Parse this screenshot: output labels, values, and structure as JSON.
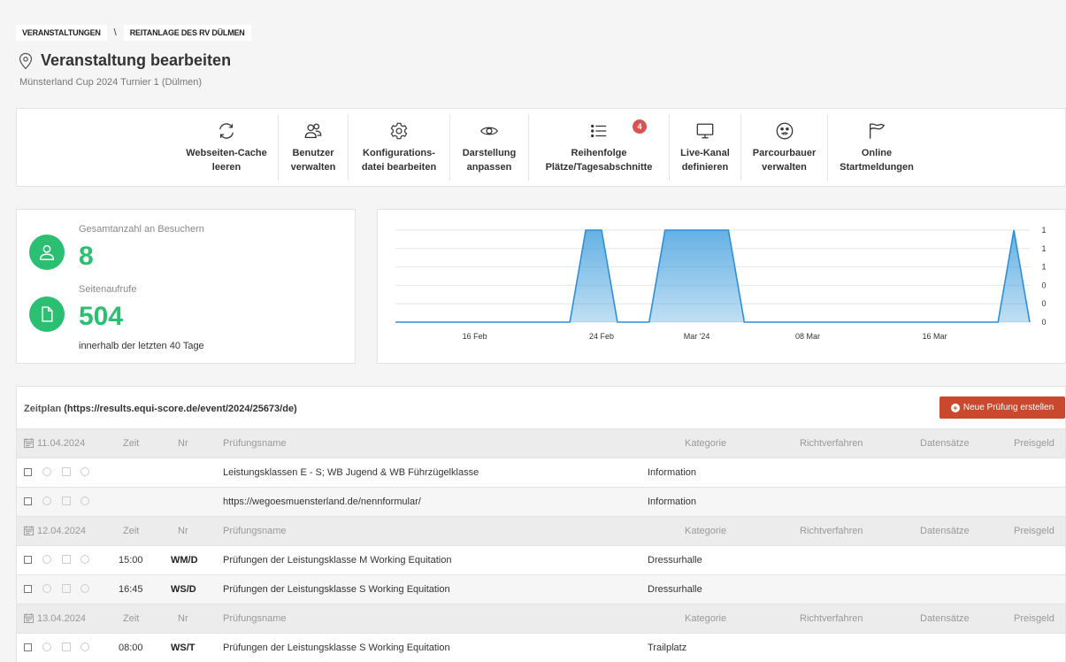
{
  "breadcrumb": {
    "items": [
      "VERANSTALTUNGEN",
      "REITANLAGE DES RV DÜLMEN"
    ],
    "separator": "\\"
  },
  "page": {
    "title": "Veranstaltung bearbeiten",
    "subtitle": "Münsterland Cup 2024 Turnier 1 (Dülmen)"
  },
  "toolbar": {
    "items": [
      {
        "label": "Webseiten-Cache\nleeren",
        "icon": "refresh-icon"
      },
      {
        "label": "Benutzer\nverwalten",
        "icon": "users-icon"
      },
      {
        "label": "Konfigurations-\ndatei bearbeiten",
        "icon": "gear-icon"
      },
      {
        "label": "Darstellung\nanpassen",
        "icon": "eye-icon"
      },
      {
        "label": "Reihenfolge\nPlätze/Tagesabschnitte",
        "icon": "list-icon",
        "badge": "4"
      },
      {
        "label": "Live-Kanal\ndefinieren",
        "icon": "monitor-icon"
      },
      {
        "label": "Parcourbauer\nverwalten",
        "icon": "face-icon"
      },
      {
        "label": "Online\nStartmeldungen",
        "icon": "flag-icon"
      }
    ]
  },
  "stats": {
    "visitors_label": "Gesamtanzahl an Besuchern",
    "visitors_value": "8",
    "pageviews_label": "Seitenaufrufe",
    "pageviews_value": "504",
    "period": "innerhalb der letzten 40 Tage",
    "accent": "#2bbf72"
  },
  "chart_data": {
    "type": "area",
    "x_start": "2024-02-11",
    "x": [
      "2024-02-11",
      "2024-02-12",
      "2024-02-13",
      "2024-02-14",
      "2024-02-15",
      "2024-02-16",
      "2024-02-17",
      "2024-02-18",
      "2024-02-19",
      "2024-02-20",
      "2024-02-21",
      "2024-02-22",
      "2024-02-23",
      "2024-02-24",
      "2024-02-25",
      "2024-02-26",
      "2024-02-27",
      "2024-02-28",
      "2024-02-29",
      "2024-03-01",
      "2024-03-02",
      "2024-03-03",
      "2024-03-04",
      "2024-03-05",
      "2024-03-06",
      "2024-03-07",
      "2024-03-08",
      "2024-03-09",
      "2024-03-10",
      "2024-03-11",
      "2024-03-12",
      "2024-03-13",
      "2024-03-14",
      "2024-03-15",
      "2024-03-16",
      "2024-03-17",
      "2024-03-18",
      "2024-03-19",
      "2024-03-20",
      "2024-03-21",
      "2024-03-22"
    ],
    "series": [
      {
        "values": [
          0,
          0,
          0,
          0,
          0,
          0,
          0,
          0,
          0,
          0,
          0,
          0,
          1,
          1,
          0,
          0,
          0,
          1,
          1,
          1,
          1,
          1,
          0,
          0,
          0,
          0,
          0,
          0,
          0,
          0,
          0,
          0,
          0,
          0,
          0,
          0,
          0,
          0,
          0,
          1,
          0
        ]
      }
    ],
    "x_tick_labels": [
      "16 Feb",
      "24 Feb",
      "Mar '24",
      "08 Mar",
      "16 Mar"
    ],
    "y_tick_labels": [
      "1",
      "1",
      "1",
      "0",
      "0",
      "0"
    ],
    "ylim": [
      0,
      1
    ],
    "grid": true,
    "color": "#4aa3df"
  },
  "schedule": {
    "title_prefix": "Zeitplan",
    "title_url": "(https://results.equi-score.de/event/2024/25673/de)",
    "new_button": "Neue Prüfung erstellen",
    "columns": {
      "time": "Zeit",
      "nr": "Nr",
      "name": "Prüfungsname",
      "category": "Kategorie",
      "judging": "Richtverfahren",
      "records": "Datensätze",
      "prize": "Preisgeld"
    },
    "days": [
      {
        "date": "11.04.2024",
        "rows": [
          {
            "time": "",
            "nr": "",
            "name": "Leistungsklassen E - S; WB Jugend & WB Führzügelklasse",
            "category": "Information"
          },
          {
            "time": "",
            "nr": "",
            "name": "https://wegoesmuensterland.de/nennformular/",
            "category": "Information"
          }
        ]
      },
      {
        "date": "12.04.2024",
        "rows": [
          {
            "time": "15:00",
            "nr": "WM/D",
            "name": "Prüfungen der Leistungsklasse M Working Equitation",
            "category": "Dressurhalle"
          },
          {
            "time": "16:45",
            "nr": "WS/D",
            "name": "Prüfungen der Leistungsklasse S Working Equitation",
            "category": "Dressurhalle"
          }
        ]
      },
      {
        "date": "13.04.2024",
        "rows": [
          {
            "time": "08:00",
            "nr": "WS/T",
            "name": "Prüfungen der Leistungsklasse S Working Equitation",
            "category": "Trailplatz"
          }
        ]
      }
    ]
  }
}
